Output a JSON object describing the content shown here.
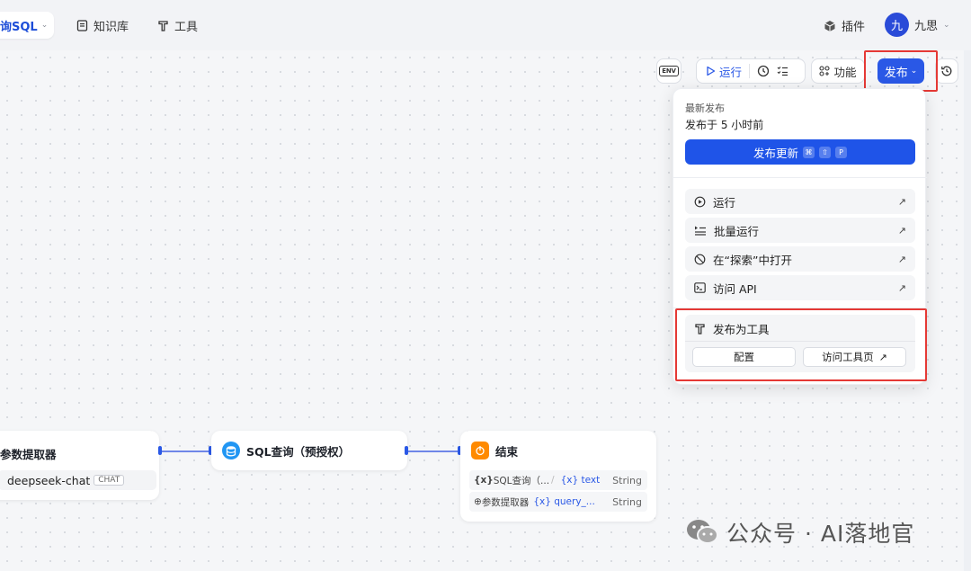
{
  "topbar": {
    "app_tab": "询SQL",
    "nav": [
      {
        "label": "知识库",
        "icon": "book-icon"
      },
      {
        "label": "工具",
        "icon": "tool-icon"
      }
    ],
    "plugin_label": "插件",
    "user": {
      "avatar_text": "九",
      "name": "九思"
    }
  },
  "toolbar": {
    "env_label": "ENV",
    "run_label": "运行",
    "feature_label": "功能",
    "publish_label": "发布"
  },
  "publish_menu": {
    "latest_label": "最新发布",
    "published_time": "发布于 5 小时前",
    "update_button": "发布更新",
    "shortcut_keys": [
      "⌘",
      "⇧",
      "P"
    ],
    "items": [
      {
        "label": "运行",
        "icon": "play-circle-icon"
      },
      {
        "label": "批量运行",
        "icon": "batch-run-icon"
      },
      {
        "label": "在“探索”中打开",
        "icon": "explore-icon"
      },
      {
        "label": "访问 API",
        "icon": "terminal-icon"
      }
    ],
    "tool_section": {
      "title": "发布为工具",
      "configure_label": "配置",
      "visit_label": "访问工具页"
    }
  },
  "nodes": {
    "extractor": {
      "title": "参数提取器",
      "model": "deepseek-chat",
      "model_tag": "CHAT"
    },
    "sql": {
      "title": "SQL查询（预授权）"
    },
    "end": {
      "title": "结束",
      "outputs": [
        {
          "prefix": "{x}",
          "source": "SQL查询（...",
          "var": "{x} text",
          "type": "String"
        },
        {
          "prefix": "⊕",
          "source": "参数提取器",
          "var": "{x} query_...",
          "type": "String"
        }
      ]
    }
  },
  "watermark": "公众号 · AI落地官",
  "colors": {
    "accent": "#2a58e6",
    "highlight": "#e53935",
    "end_node": "#ff8a00",
    "sql_node": "#2196f3"
  }
}
